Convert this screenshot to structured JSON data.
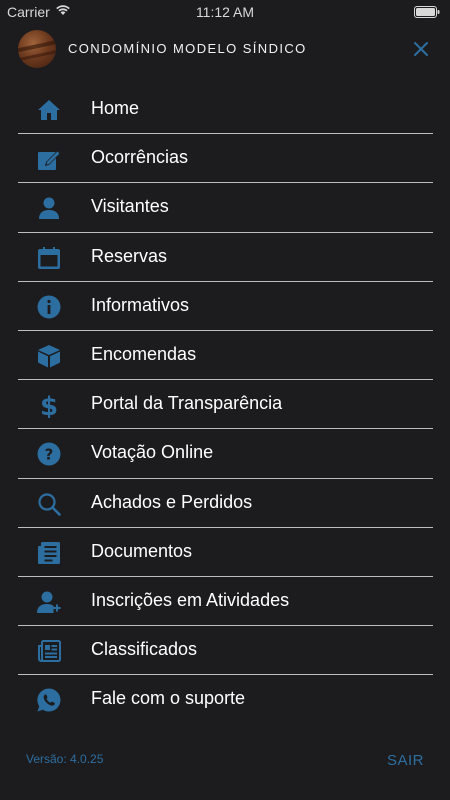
{
  "status_bar": {
    "carrier": "Carrier",
    "time": "11:12 AM"
  },
  "header": {
    "title": "CONDOMÍNIO MODELO SÍNDICO"
  },
  "menu": [
    {
      "label": "Home",
      "icon": "home-icon"
    },
    {
      "label": "Ocorrências",
      "icon": "edit-icon"
    },
    {
      "label": "Visitantes",
      "icon": "user-icon"
    },
    {
      "label": "Reservas",
      "icon": "calendar-icon"
    },
    {
      "label": "Informativos",
      "icon": "info-icon"
    },
    {
      "label": "Encomendas",
      "icon": "package-icon"
    },
    {
      "label": "Portal da Transparência",
      "icon": "dollar-icon"
    },
    {
      "label": "Votação Online",
      "icon": "question-icon"
    },
    {
      "label": "Achados e Perdidos",
      "icon": "search-icon"
    },
    {
      "label": "Documentos",
      "icon": "document-icon"
    },
    {
      "label": "Inscrições em Atividades",
      "icon": "user-add-icon"
    },
    {
      "label": "Classificados",
      "icon": "newspaper-icon"
    },
    {
      "label": "Fale com o suporte",
      "icon": "whatsapp-icon"
    }
  ],
  "footer": {
    "version": "Versão: 4.0.25",
    "logout": "SAIR"
  },
  "colors": {
    "background": "#1c1c1e",
    "accent": "#2d6ea1",
    "text": "#ffffff",
    "divider": "#bdbdbd"
  }
}
